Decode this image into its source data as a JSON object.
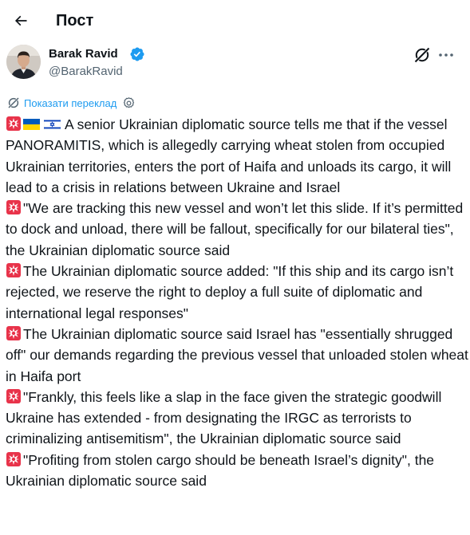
{
  "header": {
    "title": "Пост"
  },
  "author": {
    "name": "Barak Ravid",
    "handle": "@BarakRavid"
  },
  "translate": {
    "label": "Показати переклад"
  },
  "tweet": {
    "paragraphs": [
      {
        "flags": [
          "ukraine-flag",
          "israel-flag"
        ],
        "text": "A senior Ukrainian diplomatic source tells me that if the vessel PANORAMITIS, which is allegedly carrying wheat stolen from occupied Ukrainian territories, enters the port of Haifa and unloads its cargo, it will lead to a crisis in relations between Ukraine and Israel"
      },
      {
        "text": "\"We are tracking this new vessel and won’t let this slide. If it’s permitted to dock and unload, there will be fallout, specifically for our bilateral ties\", the Ukrainian diplomatic source said"
      },
      {
        "text": "The Ukrainian diplomatic source added: \"If this ship and its cargo isn’t rejected, we reserve the right to deploy a full suite of diplomatic and international legal responses\""
      },
      {
        "text": "The Ukrainian diplomatic source said Israel has \"essentially shrugged off\" our demands regarding the previous vessel that unloaded stolen wheat in Haifa port"
      },
      {
        "text": "\"Frankly, this feels like a slap in the face given the strategic goodwill Ukraine has extended - from designating the IRGC as terrorists to criminalizing antisemitism\", the Ukrainian diplomatic source said"
      },
      {
        "text": "\"Profiting from stolen cargo should be beneath Israel’s dignity\", the Ukrainian diplomatic source said"
      }
    ]
  },
  "colors": {
    "accent": "#1d9bf0",
    "secondary_text": "#536471",
    "siren_red": "#e8334a"
  },
  "icons": [
    "back-arrow-icon",
    "verified-badge-icon",
    "grok-icon",
    "more-icon",
    "translate-icon",
    "settings-gear-icon",
    "siren-emoji-icon",
    "ukraine-flag-icon",
    "israel-flag-icon"
  ]
}
